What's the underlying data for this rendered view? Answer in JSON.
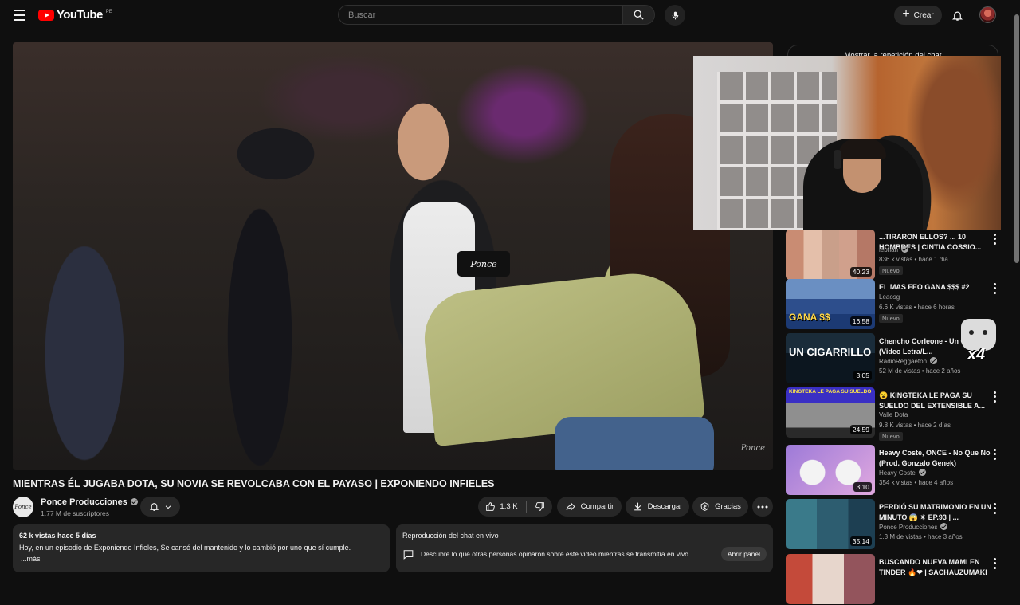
{
  "header": {
    "logo_text": "YouTube",
    "region": "PE",
    "search_placeholder": "Buscar",
    "create_label": "Crear"
  },
  "player": {
    "mic_label": "Ponce",
    "watermark": "Ponce"
  },
  "video": {
    "title": "MIENTRAS ÉL JUGABA DOTA, SU NOVIA SE REVOLCABA CON EL PAYASO | EXPONIENDO INFIELES",
    "channel": {
      "name": "Ponce Producciones",
      "subscribers": "1.77 M de suscriptores",
      "avatar_text": "Ponce"
    },
    "actions": {
      "likes": "1.3 K",
      "share": "Compartir",
      "download": "Descargar",
      "thanks": "Gracias"
    },
    "description": {
      "meta": "62 k vistas  hace 5 días",
      "text": "Hoy, en un episodio  de Exponiendo Infieles, Se cansó del mantenido y lo cambió por uno que sí cumple.",
      "more": "...más"
    },
    "chat_replay": {
      "heading": "Reproducción del chat en vivo",
      "text": "Descubre lo que otras personas opinaron sobre este video mientras se transmitía en vivo.",
      "button": "Abrir panel"
    }
  },
  "sidebar": {
    "chat_toggle": "Mostrar la repetición del chat",
    "recommendations": [
      {
        "title": "...TIRARON ELLOS? ... 10 HOMBRES | CINTIA COSSIO...",
        "channel": "lebriah",
        "verified": true,
        "stats": "836 k vistas • hace 1 día",
        "duration": "40:23",
        "badge": "Nuevo",
        "thumb_text": ""
      },
      {
        "title": "EL MAS FEO GANA $$$ #2",
        "channel": "Leaosg",
        "verified": false,
        "stats": "6.6 K vistas • hace 6 horas",
        "duration": "16:58",
        "badge": "Nuevo",
        "thumb_text": "GANA $$"
      },
      {
        "title": "Chencho Corleone - Un Cigarrillo (Video Letra/L...",
        "channel": "RadioReggaeton",
        "verified": true,
        "stats": "52 M de vistas • hace 2 años",
        "duration": "3:05",
        "badge": "",
        "thumb_text": "UN CIGARRILLO"
      },
      {
        "title": "😮 KINGTEKA LE PAGA SU SUELDO DEL EXTENSIBLE A...",
        "channel": "Valle Dota",
        "verified": false,
        "stats": "9.8 K vistas • hace 2 días",
        "duration": "24:59",
        "badge": "Nuevo",
        "thumb_text": "KINGTEKA LE PAGA SU SUELDO"
      },
      {
        "title": "Heavy Coste, ONCE - No Que No (Prod. Gonzalo Genek)",
        "channel": "Heavy Coste",
        "verified": true,
        "stats": "354 k vistas • hace 4 años",
        "duration": "3:10",
        "badge": "",
        "thumb_text": ""
      },
      {
        "title": "PERDIÓ SU MATRIMONIO EN UN MINUTO 😱 ✴ EP.93 | ...",
        "channel": "Ponce Producciones",
        "verified": true,
        "stats": "1.3 M de vistas • hace 3 años",
        "duration": "35:14",
        "badge": "",
        "thumb_text": ""
      },
      {
        "title": "BUSCANDO NUEVA MAMI EN TINDER 🔥❤ | SACHAUZUMAKI",
        "channel": "",
        "verified": false,
        "stats": "",
        "duration": "",
        "badge": "",
        "thumb_text": ""
      }
    ],
    "overlay_text": "x4"
  }
}
